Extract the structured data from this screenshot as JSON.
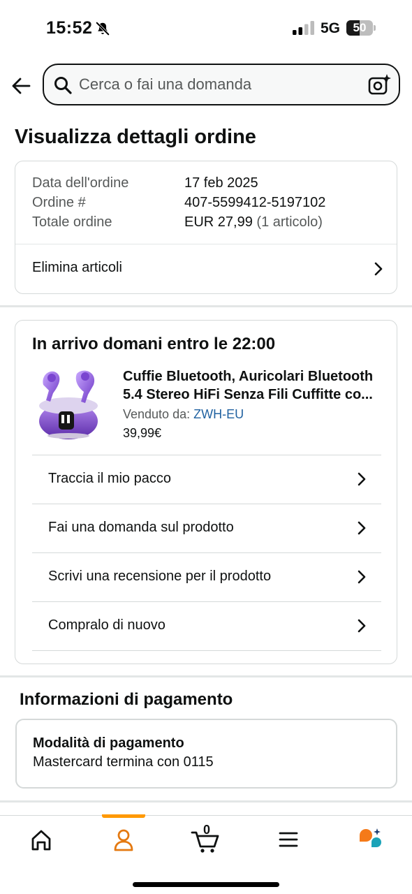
{
  "status_bar": {
    "time": "15:52",
    "network": "5G",
    "battery": "50",
    "battery_level": 0.5,
    "icons": [
      "bell-slash-icon",
      "signal-icon",
      "battery-icon"
    ]
  },
  "header": {
    "search_placeholder": "Cerca o fai una domanda",
    "icons": [
      "back-arrow-icon",
      "search-icon",
      "camera-sparkle-icon"
    ]
  },
  "page_title": "Visualizza dettagli ordine",
  "order_summary": {
    "date_label": "Data dell'ordine",
    "date_value": "17 feb 2025",
    "number_label": "Ordine #",
    "number_value": "407-5599412-5197102",
    "total_label": "Totale ordine",
    "total_value": "EUR 27,99",
    "total_items": "(1 articolo)",
    "delete_items": "Elimina articoli"
  },
  "shipment": {
    "heading": "In arrivo domani entro le 22:00",
    "product": {
      "title_line1": "Cuffie Bluetooth, Auricolari Bluetooth",
      "title_line2": "5.4 Stereo HiFi Senza Fili Cuffitte co...",
      "sold_by_label": "Venduto da:",
      "seller": "ZWH-EU",
      "price": "39,99€",
      "image": "purple-earbuds-image"
    },
    "actions": [
      "Traccia il mio pacco",
      "Fai una domanda sul prodotto",
      "Scrivi una recensione per il prodotto",
      "Compralo di nuovo"
    ]
  },
  "payment": {
    "heading": "Informazioni di pagamento",
    "method_label": "Modalità di pagamento",
    "method_value": "Mastercard termina con 0115"
  },
  "bottom_nav": {
    "cart_count": "0",
    "items": [
      "home-icon",
      "account-icon",
      "cart-icon",
      "menu-icon",
      "assistant-icon"
    ],
    "active": "account-icon",
    "accent_color": "#ff9900"
  },
  "colors": {
    "text": "#0f1111",
    "muted": "#565959",
    "link": "#2162a1",
    "border": "#d5d9d9"
  }
}
